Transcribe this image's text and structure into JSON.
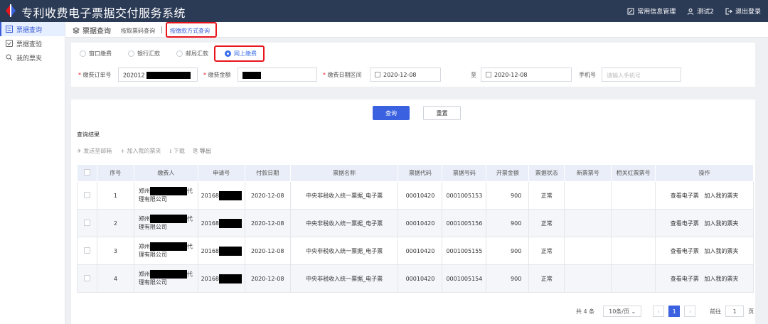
{
  "header": {
    "title": "专利收费电子票据交付服务系统",
    "nav": [
      "常用信息管理",
      "测试2",
      "退出登录"
    ]
  },
  "sidebar": {
    "items": [
      "票据查询",
      "票据查验",
      "我的票夹"
    ]
  },
  "tabs": {
    "main": "票据查询",
    "by_code": "按取票码查询",
    "by_payment": "按缴款方式查询"
  },
  "payment_methods": [
    "窗口缴费",
    "银行汇款",
    "邮局汇款",
    "网上缴费"
  ],
  "form": {
    "order_label": "缴费订单号",
    "order_value": "202012",
    "amount_label": "缴费金额",
    "date_label": "缴费日期区间",
    "date_from": "2020-12-08",
    "to": "至",
    "date_to": "2020-12-08",
    "phone_label": "手机号",
    "phone_placeholder": "请输入手机号"
  },
  "buttons": {
    "search": "查询",
    "reset": "重置"
  },
  "result_title": "查询结果",
  "toolbar": [
    "发送至邮箱",
    "加入我的票夹",
    "下载",
    "导出"
  ],
  "table": {
    "headers": [
      "序号",
      "缴费人",
      "申请号",
      "付款日期",
      "票据名称",
      "票据代码",
      "票据号码",
      "开票金额",
      "票据状态",
      "新票票号",
      "相关红票票号",
      "操作"
    ],
    "payer_prefix": "郑州",
    "payer_suffix": "代",
    "payer_line2": "理有限公司",
    "app_prefix": "20168",
    "rows": [
      {
        "no": "1",
        "date": "2020-12-08",
        "name": "中央非税收入统一票据_电子票",
        "code": "00010420",
        "number": "0001005153",
        "amount": "900",
        "status": "正常"
      },
      {
        "no": "2",
        "date": "2020-12-08",
        "name": "中央非税收入统一票据_电子票",
        "code": "00010420",
        "number": "0001005156",
        "amount": "900",
        "status": "正常"
      },
      {
        "no": "3",
        "date": "2020-12-08",
        "name": "中央非税收入统一票据_电子票",
        "code": "00010420",
        "number": "0001005155",
        "amount": "900",
        "status": "正常"
      },
      {
        "no": "4",
        "date": "2020-12-08",
        "name": "中央非税收入统一票据_电子票",
        "code": "00010420",
        "number": "0001005154",
        "amount": "900",
        "status": "正常"
      }
    ],
    "action_view": "查看电子票",
    "action_add": "加入我的票夹"
  },
  "pager": {
    "total": "共 4 条",
    "per_page": "10条/页",
    "current": "1",
    "goto": "前往",
    "goto_value": "1",
    "page_unit": "页"
  }
}
